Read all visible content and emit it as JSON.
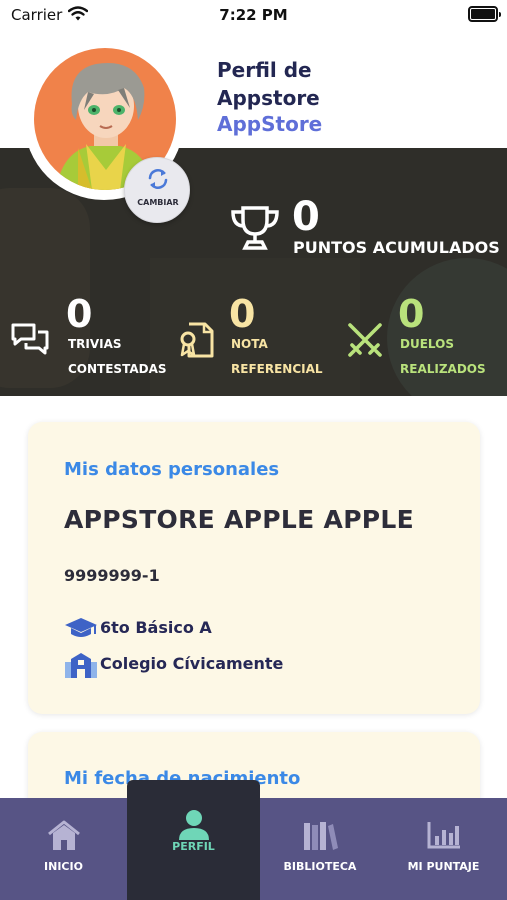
{
  "status_bar": {
    "carrier": "Carrier",
    "time": "7:22 PM"
  },
  "profile": {
    "title": "Perfil de Appstore",
    "subtitle": "AppStore",
    "change_avatar_label": "CAMBIAR"
  },
  "points": {
    "value": "0",
    "label": "PUNTOS ACUMULADOS"
  },
  "stats": [
    {
      "value": "0",
      "label": "TRIVIAS CONTESTADAS",
      "color": "#ffffff",
      "icon": "chat-bubbles-icon"
    },
    {
      "value": "0",
      "label": "NOTA REFERENCIAL",
      "color": "#f8e4a4",
      "icon": "certificate-icon"
    },
    {
      "value": "0",
      "label": "DUELOS REALIZADOS",
      "color": "#b9e27c",
      "icon": "crossed-swords-icon"
    }
  ],
  "personal": {
    "heading": "Mis datos personales",
    "full_name": "APPSTORE APPLE APPLE",
    "rut": "9999999-1",
    "grade": "6to Básico A",
    "school": "Colegio Cívicamente"
  },
  "birth": {
    "heading": "Mi fecha de nacimiento"
  },
  "tabs": [
    {
      "label": "INICIO",
      "icon": "home-icon",
      "active": false
    },
    {
      "label": "PERFIL",
      "icon": "user-icon",
      "active": true
    },
    {
      "label": "BIBLIOTECA",
      "icon": "books-icon",
      "active": false
    },
    {
      "label": "MI PUNTAJE",
      "icon": "bar-chart-icon",
      "active": false
    }
  ],
  "colors": {
    "accent": "#5f6fd8",
    "heading_blue": "#3b89e6",
    "tabbar": "#575485",
    "tab_active": "#2a2c37",
    "tab_active_text": "#6fd6b7"
  }
}
